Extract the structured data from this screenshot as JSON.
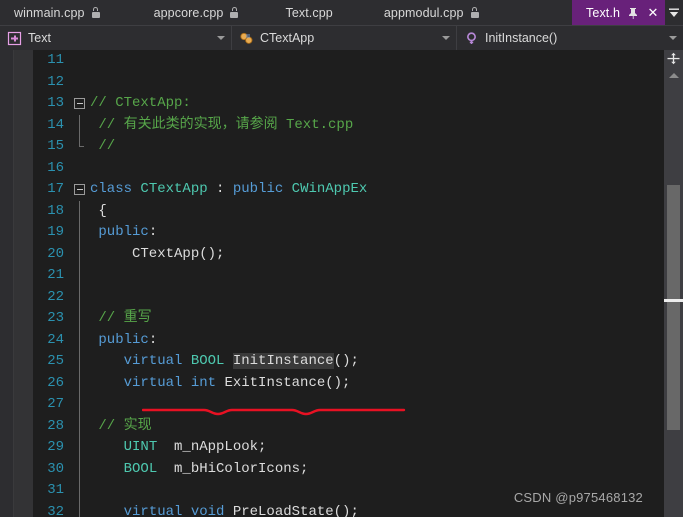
{
  "window": {
    "app": "Visual Studio",
    "theme_background": "#1E1E1E",
    "accent_purple": "#68217A"
  },
  "tabbar": {
    "tabs": [
      {
        "label": "winmain.cpp",
        "locked": true,
        "active": false
      },
      {
        "label": "appcore.cpp",
        "locked": true,
        "active": false
      },
      {
        "label": "Text.cpp",
        "locked": false,
        "active": false
      },
      {
        "label": "appmodul.cpp",
        "locked": true,
        "active": false
      },
      {
        "label": "Text.h",
        "locked": false,
        "active": true
      }
    ],
    "active_tab_pin_title": "Pin Tab",
    "active_tab_close_label": "✕",
    "overflow_title": "Active Files"
  },
  "navbar": {
    "project": {
      "label": "Text",
      "icon": "project-icon"
    },
    "class": {
      "label": "CTextApp",
      "icon": "class-icon"
    },
    "member": {
      "label": "InitInstance()",
      "icon": "method-icon"
    }
  },
  "editor": {
    "first_line_number": 11,
    "lines": [
      {
        "n": 11,
        "fold": "none",
        "tokens": []
      },
      {
        "n": 12,
        "fold": "none",
        "tokens": []
      },
      {
        "n": 13,
        "fold": "start",
        "tokens": [
          {
            "t": "// CTextApp:",
            "c": "tk-com"
          }
        ]
      },
      {
        "n": 14,
        "fold": "mid",
        "tokens": [
          {
            "t": " // 有关此类的实现，请参阅 Text.cpp",
            "c": "tk-com"
          }
        ]
      },
      {
        "n": 15,
        "fold": "end",
        "tokens": [
          {
            "t": " //",
            "c": "tk-com"
          }
        ]
      },
      {
        "n": 16,
        "fold": "none",
        "tokens": []
      },
      {
        "n": 17,
        "fold": "start",
        "tokens": [
          {
            "t": "class ",
            "c": "tk-key"
          },
          {
            "t": "CTextApp ",
            "c": "tk-type"
          },
          {
            "t": ": ",
            "c": "tk-plain"
          },
          {
            "t": "public ",
            "c": "tk-key"
          },
          {
            "t": "CWinAppEx",
            "c": "tk-type"
          }
        ]
      },
      {
        "n": 18,
        "fold": "mid",
        "tokens": [
          {
            "t": " {",
            "c": "tk-plain"
          }
        ]
      },
      {
        "n": 19,
        "fold": "mid",
        "tokens": [
          {
            "t": " public",
            "c": "tk-key"
          },
          {
            "t": ":",
            "c": "tk-plain"
          }
        ]
      },
      {
        "n": 20,
        "fold": "mid",
        "tokens": [
          {
            "t": "     CTextApp();",
            "c": "tk-plain"
          }
        ]
      },
      {
        "n": 21,
        "fold": "mid",
        "tokens": []
      },
      {
        "n": 22,
        "fold": "mid",
        "tokens": []
      },
      {
        "n": 23,
        "fold": "mid",
        "tokens": [
          {
            "t": " // 重写",
            "c": "tk-com"
          }
        ]
      },
      {
        "n": 24,
        "fold": "mid",
        "tokens": [
          {
            "t": " public",
            "c": "tk-key"
          },
          {
            "t": ":",
            "c": "tk-plain"
          }
        ]
      },
      {
        "n": 25,
        "fold": "mid",
        "tokens": [
          {
            "t": "    ",
            "c": "tk-plain"
          },
          {
            "t": "virtual ",
            "c": "tk-key"
          },
          {
            "t": "BOOL ",
            "c": "tk-type"
          },
          {
            "t": "InitInstance",
            "c": "tk-plain tk-hl"
          },
          {
            "t": "();",
            "c": "tk-plain"
          }
        ]
      },
      {
        "n": 26,
        "fold": "mid",
        "tokens": [
          {
            "t": "    ",
            "c": "tk-plain"
          },
          {
            "t": "virtual int ",
            "c": "tk-key"
          },
          {
            "t": "ExitInstance();",
            "c": "tk-plain"
          }
        ]
      },
      {
        "n": 27,
        "fold": "mid",
        "tokens": []
      },
      {
        "n": 28,
        "fold": "mid",
        "tokens": [
          {
            "t": " // 实现",
            "c": "tk-com"
          }
        ]
      },
      {
        "n": 29,
        "fold": "mid",
        "tokens": [
          {
            "t": "    ",
            "c": "tk-plain"
          },
          {
            "t": "UINT",
            "c": "tk-type"
          },
          {
            "t": "  m_nAppLook;",
            "c": "tk-plain"
          }
        ]
      },
      {
        "n": 30,
        "fold": "mid",
        "tokens": [
          {
            "t": "    ",
            "c": "tk-plain"
          },
          {
            "t": "BOOL",
            "c": "tk-type"
          },
          {
            "t": "  m_bHiColorIcons;",
            "c": "tk-plain"
          }
        ]
      },
      {
        "n": 31,
        "fold": "mid",
        "tokens": []
      },
      {
        "n": 32,
        "fold": "mid",
        "tokens": [
          {
            "t": "    ",
            "c": "tk-plain"
          },
          {
            "t": "virtual void ",
            "c": "tk-key"
          },
          {
            "t": "PreLoadState();",
            "c": "tk-plain"
          }
        ]
      }
    ],
    "annotation": {
      "type": "red-underline",
      "color": "#E81123",
      "targets": "virtual BOOL InitInstance();",
      "line": 25
    },
    "highlighted_word": "InitInstance"
  },
  "watermark": {
    "text": "CSDN @p975468132"
  },
  "scrollbar": {
    "split_view_title": "Split Editor",
    "scroll_up_title": "Scroll Up",
    "thumb_title": "Vertical Scrollbar"
  }
}
